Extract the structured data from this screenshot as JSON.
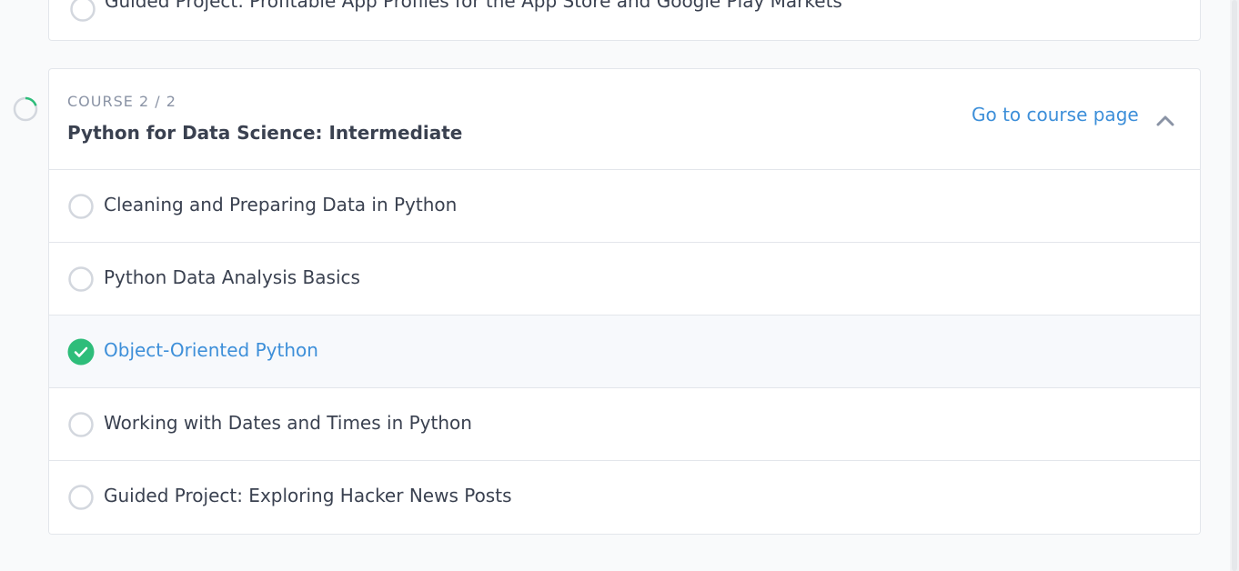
{
  "previous_course": {
    "last_item": {
      "label": "Guided Project: Profitable App Profiles for the App Store and Google Play Markets",
      "status": "incomplete"
    }
  },
  "course": {
    "counter": "COURSE 2 / 2",
    "title": "Python for Data Science: Intermediate",
    "go_link": "Go to course page",
    "collapse_icon": "chevron-up-icon",
    "progress_icon": "progress-ring-icon",
    "lessons": [
      {
        "label": "Cleaning and Preparing Data in Python",
        "status": "incomplete"
      },
      {
        "label": "Python Data Analysis Basics",
        "status": "incomplete"
      },
      {
        "label": "Object-Oriented Python",
        "status": "complete"
      },
      {
        "label": "Working with Dates and Times in Python",
        "status": "incomplete"
      },
      {
        "label": "Guided Project: Exploring Hacker News Posts",
        "status": "incomplete"
      }
    ]
  },
  "colors": {
    "accent": "#3d8fd9",
    "complete": "#2ebd7a",
    "border": "#e3e6eb",
    "text": "#3a4150",
    "muted": "#8a93a5"
  }
}
